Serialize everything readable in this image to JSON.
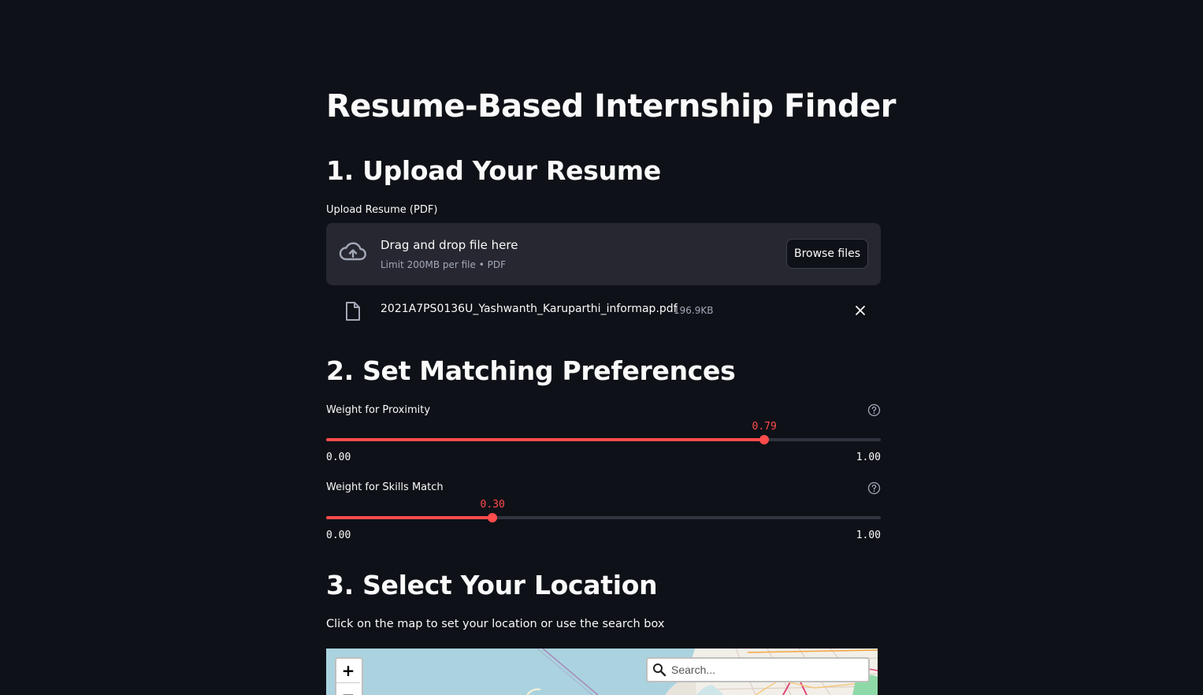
{
  "page": {
    "title": "Resume-Based Internship Finder",
    "accent_color": "#ff4b4b",
    "background_color": "#0e1117"
  },
  "upload_section": {
    "heading": "1. Upload Your Resume",
    "label": "Upload Resume (PDF)",
    "dropzone": {
      "icon": "cloud-upload-icon",
      "title": "Drag and drop file here",
      "limit": "Limit 200MB per file • PDF",
      "button_label": "Browse files"
    },
    "file": {
      "icon": "file-icon",
      "name": "2021A7PS0136U_Yashwanth_Karuparthi_informap.pdf",
      "size": "196.9KB",
      "remove_icon": "close-icon"
    }
  },
  "preferences_section": {
    "heading": "2. Set Matching Preferences",
    "sliders": [
      {
        "label": "Weight for Proximity",
        "value": 0.79,
        "value_text": "0.79",
        "min_text": "0.00",
        "max_text": "1.00",
        "min": 0,
        "max": 1,
        "help_icon": "question-circle-icon"
      },
      {
        "label": "Weight for Skills Match",
        "value": 0.3,
        "value_text": "0.30",
        "min_text": "0.00",
        "max_text": "1.00",
        "min": 0,
        "max": 1,
        "help_icon": "question-circle-icon"
      }
    ]
  },
  "location_section": {
    "heading": "3. Select Your Location",
    "instruction": "Click on the map to set your location or use the search box",
    "map": {
      "zoom_in_label": "+",
      "zoom_out_label": "−",
      "search_placeholder": "Search...",
      "search_icon": "magnifier-icon"
    }
  }
}
